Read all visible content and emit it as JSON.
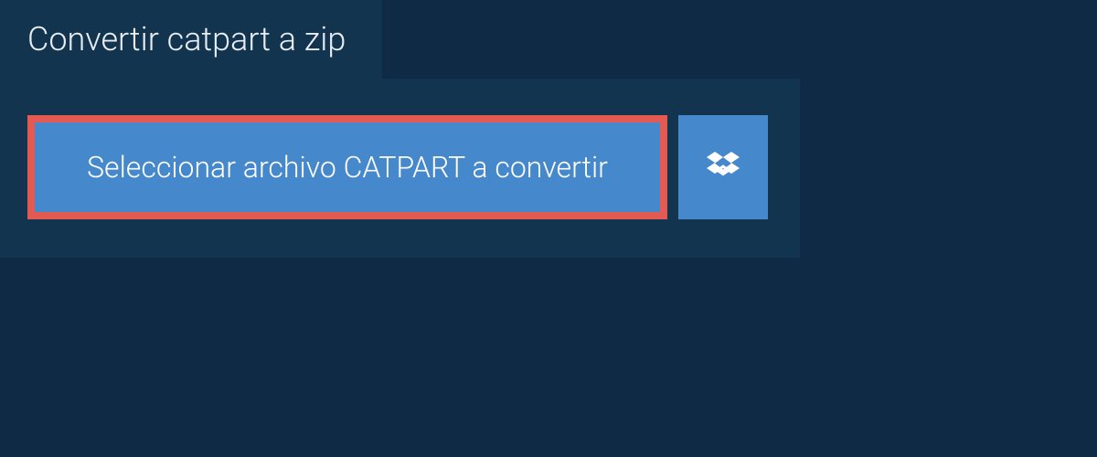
{
  "tab": {
    "title": "Convertir catpart a zip"
  },
  "panel": {
    "select_button_label": "Seleccionar archivo CATPART a convertir"
  }
}
